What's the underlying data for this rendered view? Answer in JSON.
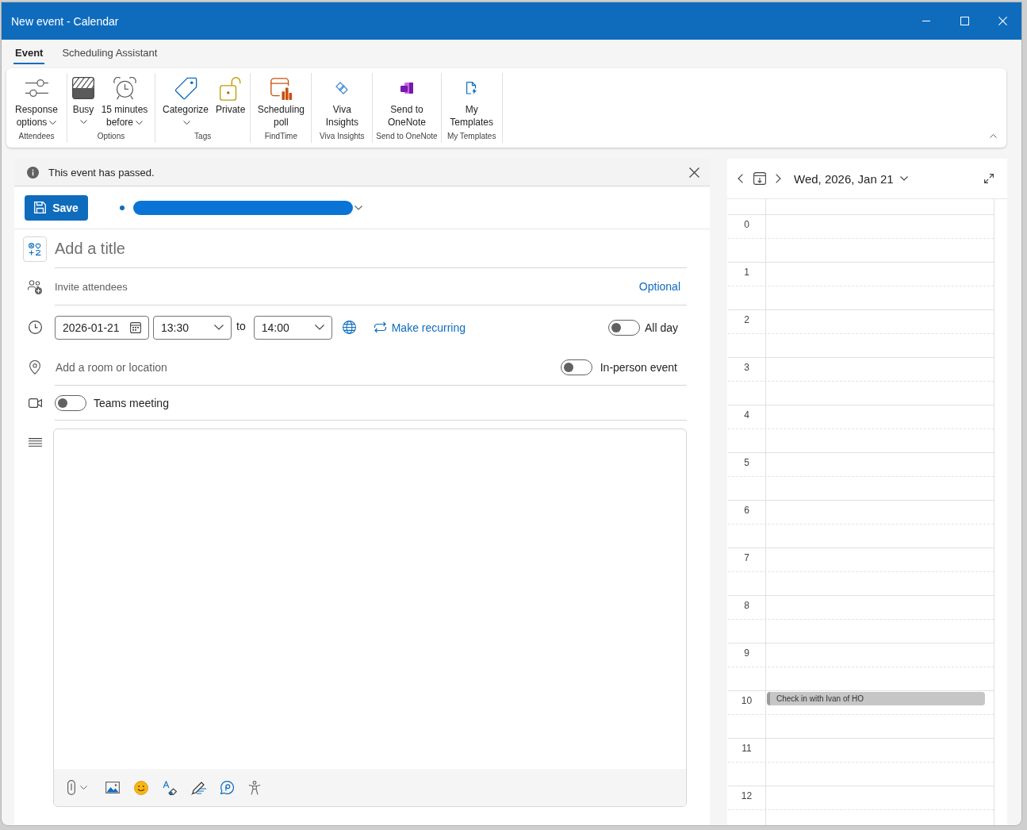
{
  "window": {
    "title": "New event - Calendar"
  },
  "tabs": [
    {
      "label": "Event",
      "selected": true
    },
    {
      "label": "Scheduling Assistant",
      "selected": false
    }
  ],
  "ribbon": {
    "groups": [
      {
        "label": "Attendees",
        "buttons": [
          {
            "label": "Response options",
            "dropdown": true
          }
        ]
      },
      {
        "label": "Options",
        "buttons": [
          {
            "label": "Busy",
            "dropdown": true
          },
          {
            "label": "15 minutes before",
            "dropdown": true
          }
        ]
      },
      {
        "label": "Tags",
        "buttons": [
          {
            "label": "Categorize",
            "dropdown": true
          },
          {
            "label": "Private",
            "dropdown": false
          }
        ]
      },
      {
        "label": "FindTime",
        "buttons": [
          {
            "label": "Scheduling poll",
            "dropdown": false
          }
        ]
      },
      {
        "label": "Viva Insights",
        "buttons": [
          {
            "label": "Viva Insights",
            "dropdown": false
          }
        ]
      },
      {
        "label": "Send to OneNote",
        "buttons": [
          {
            "label": "Send to OneNote",
            "dropdown": false
          }
        ]
      },
      {
        "label": "My Templates",
        "buttons": [
          {
            "label": "My Templates",
            "dropdown": false
          }
        ]
      }
    ]
  },
  "notice": {
    "text": "This event has passed."
  },
  "save_button": {
    "label": "Save"
  },
  "title_field": {
    "placeholder": "Add a title"
  },
  "attendees": {
    "placeholder": "Invite attendees",
    "optional_link": "Optional"
  },
  "time": {
    "date": "2026-01-21",
    "start": "13:30",
    "separator": "to",
    "end": "14:00",
    "recurring_link": "Make recurring",
    "all_day": {
      "label": "All day",
      "on": false
    }
  },
  "location": {
    "placeholder": "Add a room or location",
    "in_person": {
      "label": "In-person event",
      "on": false
    }
  },
  "teams": {
    "label": "Teams meeting",
    "on": false
  },
  "day_view": {
    "date": "Wed, 2026, Jan 21",
    "hours": [
      {
        "label": "0"
      },
      {
        "label": "1"
      },
      {
        "label": "2"
      },
      {
        "label": "3"
      },
      {
        "label": "4"
      },
      {
        "label": "5"
      },
      {
        "label": "6"
      },
      {
        "label": "7"
      },
      {
        "label": "8"
      },
      {
        "label": "9"
      },
      {
        "label": "10",
        "events": [
          {
            "title": "Check in with Ivan of HO"
          }
        ]
      },
      {
        "label": "11"
      },
      {
        "label": "12"
      }
    ]
  }
}
